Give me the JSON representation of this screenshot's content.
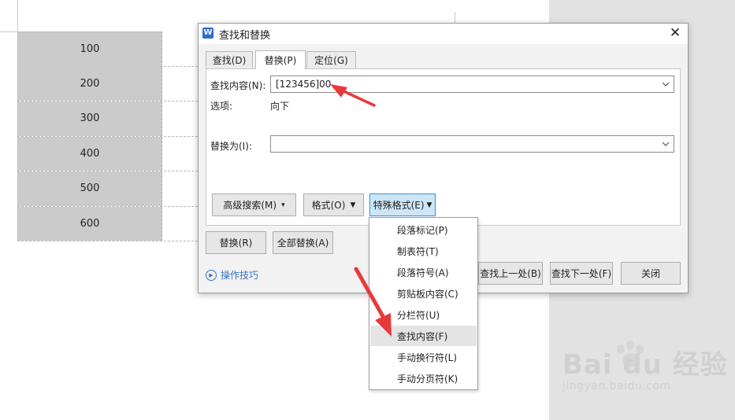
{
  "document": {
    "table_rows": [
      "100",
      "200",
      "300",
      "400",
      "500",
      "600"
    ]
  },
  "dialog": {
    "title": "查找和替换",
    "tabs": [
      {
        "label": "查找(D)"
      },
      {
        "label": "替换(P)"
      },
      {
        "label": "定位(G)"
      }
    ],
    "find_label": "查找内容(N):",
    "find_value": "[123456]00",
    "options_label": "选项:",
    "options_value": "向下",
    "replace_label": "替换为(I):",
    "replace_value": "",
    "advanced_search_label": "高级搜索(M)",
    "format_label": "格式(O)",
    "special_format_label": "特殊格式(E)",
    "replace_button": "替换(R)",
    "replace_all_button": "全部替换(A)",
    "tips_label": "操作技巧",
    "find_prev_button": "查找上一处(B)",
    "find_next_button": "查找下一处(F)",
    "close_button": "关闭"
  },
  "special_menu": {
    "items": [
      {
        "label": "段落标记(P)"
      },
      {
        "label": "制表符(T)"
      },
      {
        "label": "段落符号(A)"
      },
      {
        "label": "剪贴板内容(C)"
      },
      {
        "label": "分栏符(U)"
      },
      {
        "label": "查找内容(F)"
      },
      {
        "label": "手动换行符(L)"
      },
      {
        "label": "手动分页符(K)"
      }
    ],
    "highlighted_index": 5
  },
  "watermark": {
    "brand": "Bai du 经验",
    "url": "jingyan.baidu.com"
  },
  "colors": {
    "accent": "#3c8fd6",
    "annotation_arrow": "#e8393a",
    "link": "#3a72c2"
  }
}
